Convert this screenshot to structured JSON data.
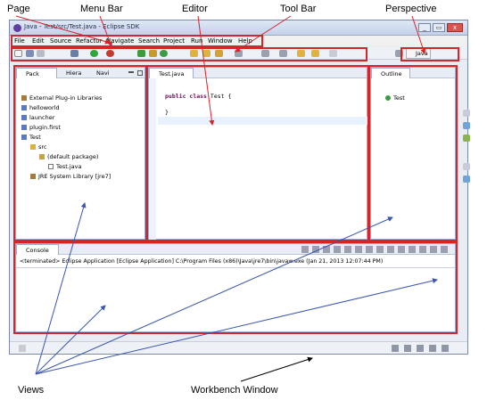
{
  "callouts": {
    "page": "Page",
    "menu_bar": "Menu Bar",
    "editor": "Editor",
    "tool_bar": "Tool Bar",
    "perspective": "Perspective",
    "views": "Views",
    "workbench_window": "Workbench Window"
  },
  "window": {
    "title": "Java - Test/src/Test.java - Eclipse SDK",
    "min": "_",
    "max": "▭",
    "close": "x"
  },
  "menu": [
    "File",
    "Edit",
    "Source",
    "Refactor",
    "Navigate",
    "Search",
    "Project",
    "Run",
    "Window",
    "Help"
  ],
  "perspective_label": "Java",
  "package_explorer": {
    "tabs": [
      "Pack",
      "Hiera",
      "Navi"
    ],
    "items": [
      "External Plug-in Libraries",
      "helloworld",
      "launcher",
      "plugin.first",
      "Test",
      "src",
      "(default package)",
      "Test.java",
      "JRE System Library [jre7]"
    ]
  },
  "editor": {
    "tab": "Test.java",
    "keywords": [
      "public",
      "class"
    ],
    "class_name": "Test",
    "brace_open": "{",
    "brace_close": "}"
  },
  "outline": {
    "tab": "Outline",
    "item": "Test"
  },
  "console": {
    "tab": "Console",
    "text": "<terminated> Eclipse Application [Eclipse Application] C:\\Program Files (x86)\\Java\\jre7\\bin\\javaw.exe (Jan 21, 2013 12:07:44 PM)"
  },
  "colors": {
    "highlight": "#d1262c",
    "keyword": "#7f0055",
    "window_border": "#7c8aa8"
  }
}
